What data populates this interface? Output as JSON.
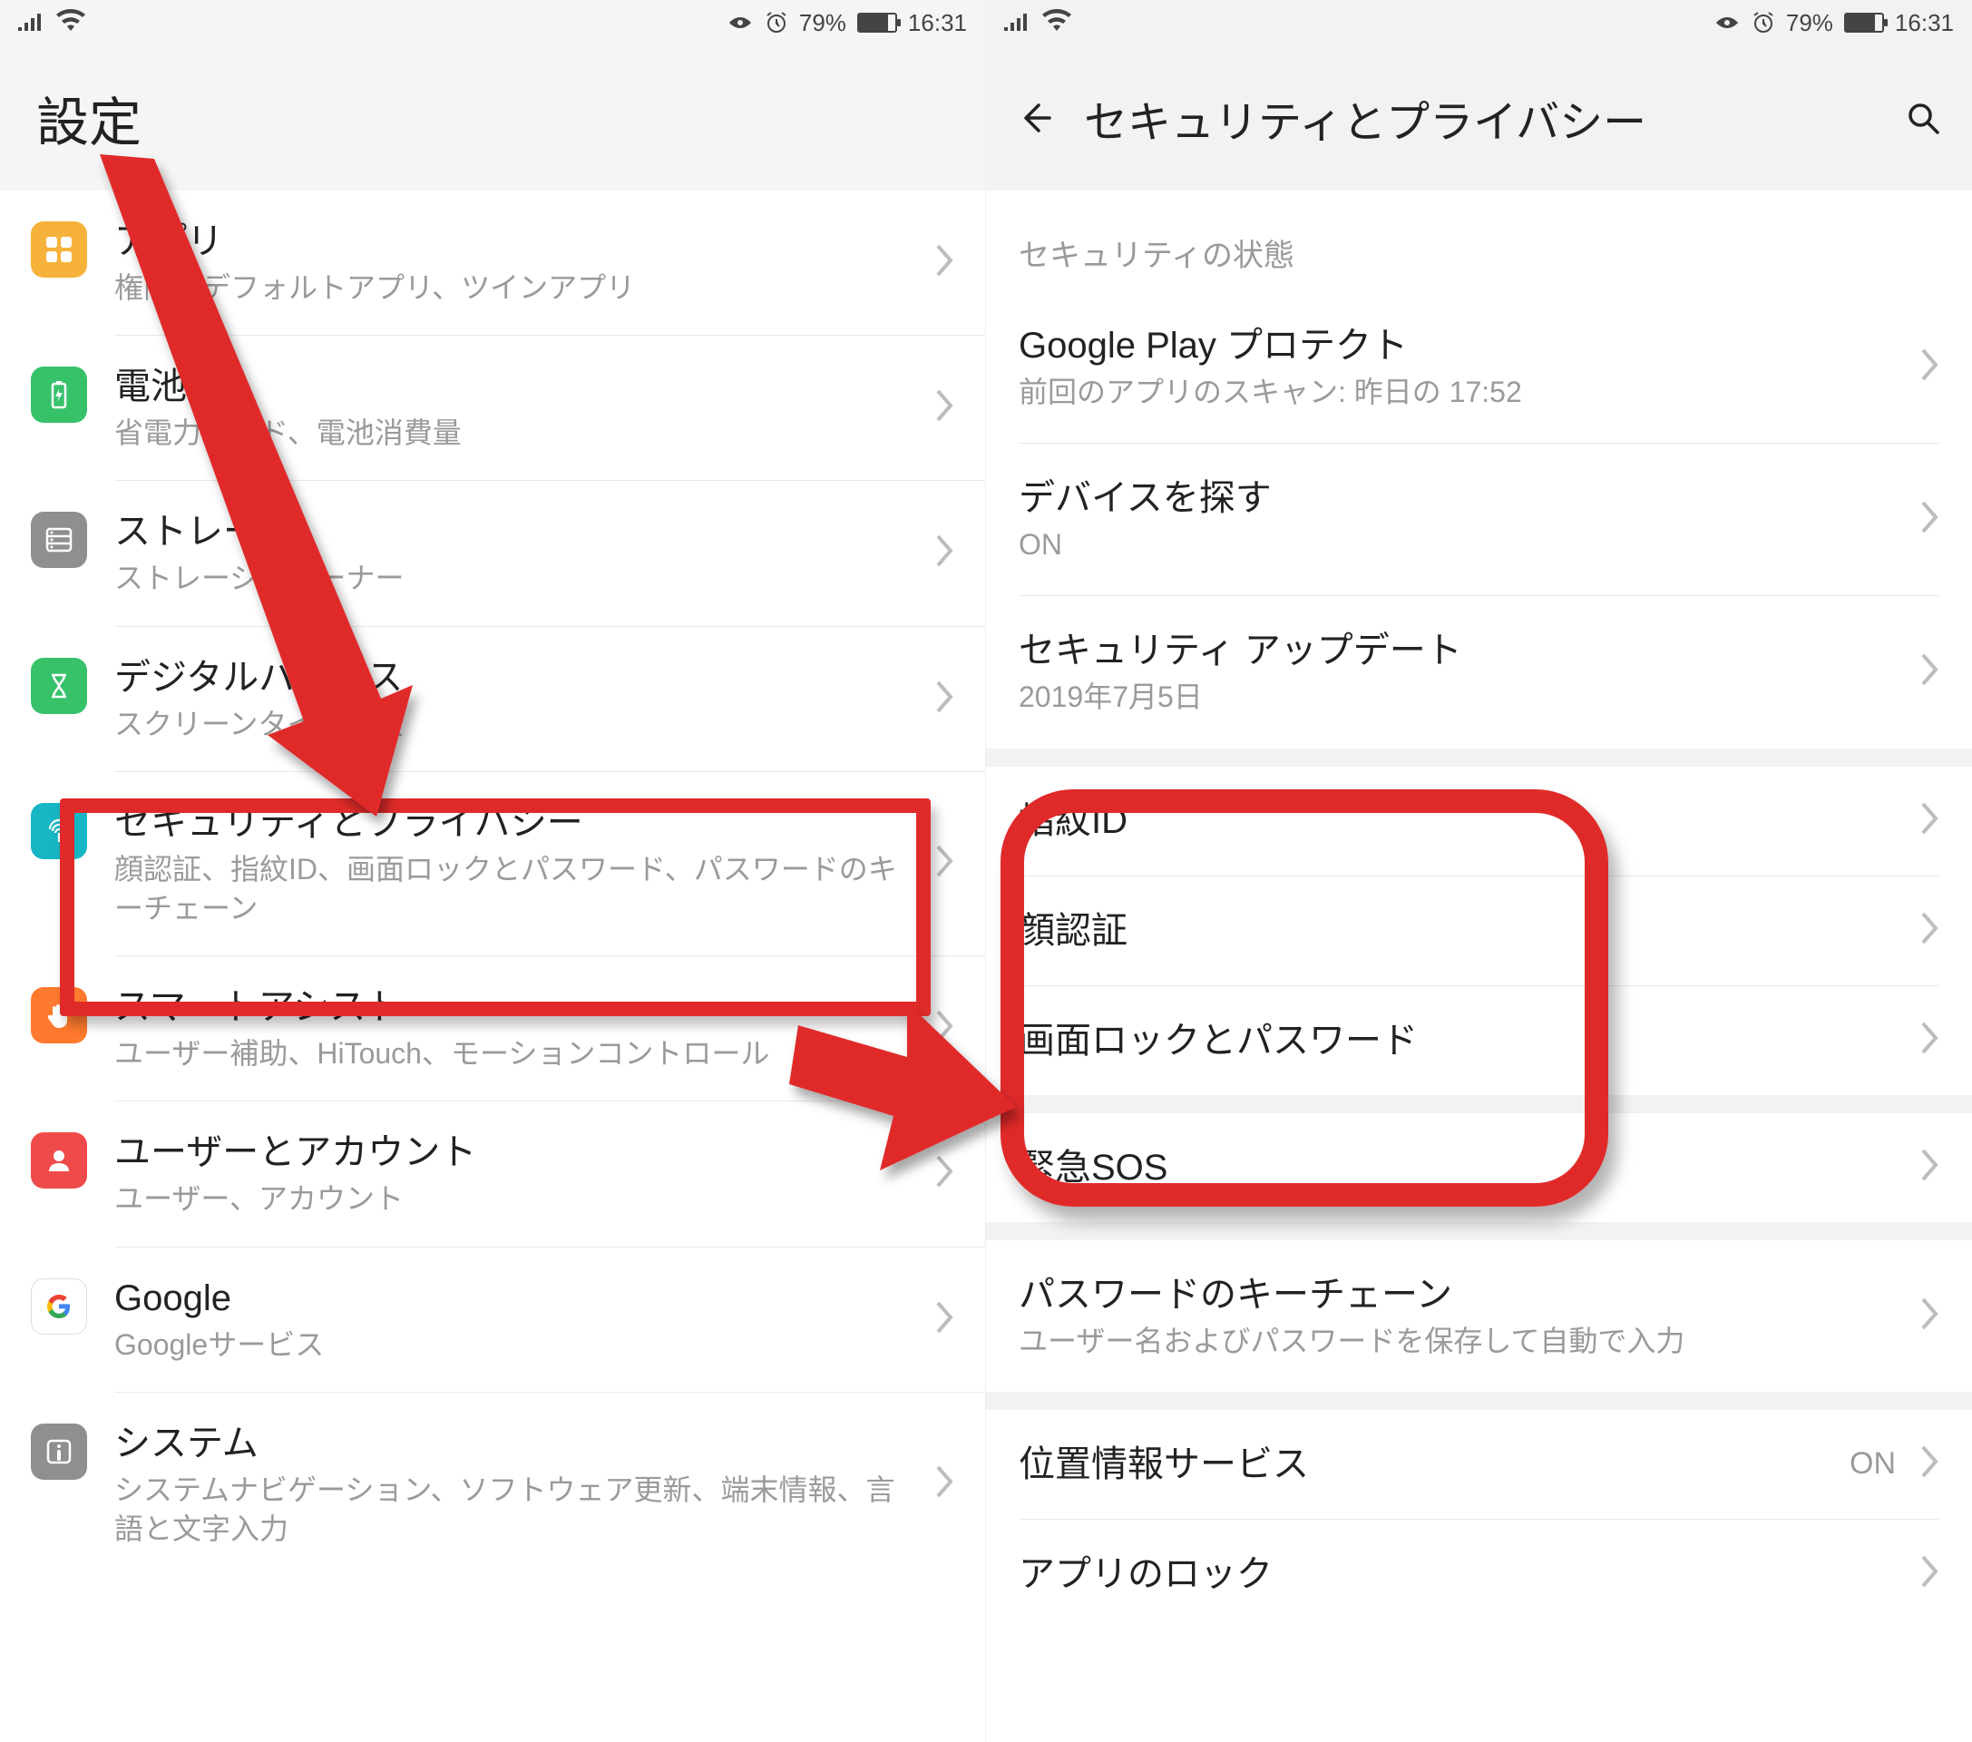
{
  "status": {
    "battery_pct": "79%",
    "time": "16:31"
  },
  "left": {
    "title": "設定",
    "items": [
      {
        "icon": "apps",
        "title": "アプリ",
        "sub": "権限、デフォルトアプリ、ツインアプリ"
      },
      {
        "icon": "battery",
        "title": "電池",
        "sub": "省電力モード、電池消費量"
      },
      {
        "icon": "storage",
        "title": "ストレージ",
        "sub": "ストレージクリーナー"
      },
      {
        "icon": "balance",
        "title": "デジタルバランス",
        "sub": "スクリーンタイム管理"
      },
      {
        "icon": "security",
        "title": "セキュリティとプライバシー",
        "sub": "顔認証、指紋ID、画面ロックとパスワード、パスワードのキーチェーン"
      },
      {
        "icon": "assist",
        "title": "スマートアシスト",
        "sub": "ユーザー補助、HiTouch、モーションコントロール"
      },
      {
        "icon": "user",
        "title": "ユーザーとアカウント",
        "sub": "ユーザー、アカウント"
      },
      {
        "icon": "google",
        "title": "Google",
        "sub": "Googleサービス"
      },
      {
        "icon": "system",
        "title": "システム",
        "sub": "システムナビゲーション、ソフトウェア更新、端末情報、言語と文字入力"
      }
    ]
  },
  "right": {
    "title": "セキュリティとプライバシー",
    "section_label": "セキュリティの状態",
    "items_top": [
      {
        "title": "Google Play プロテクト",
        "sub": "前回のアプリのスキャン: 昨日の 17:52"
      },
      {
        "title": "デバイスを探す",
        "sub": "ON"
      },
      {
        "title": "セキュリティ アップデート",
        "sub": "2019年7月5日"
      }
    ],
    "items_auth": [
      {
        "title": "指紋ID"
      },
      {
        "title": "顔認証"
      },
      {
        "title": "画面ロックとパスワード"
      }
    ],
    "items_mid": [
      {
        "title": "緊急SOS"
      }
    ],
    "items_kc": [
      {
        "title": "パスワードのキーチェーン",
        "sub": "ユーザー名およびパスワードを保存して自動で入力"
      }
    ],
    "items_bottom": [
      {
        "title": "位置情報サービス",
        "value": "ON"
      },
      {
        "title": "アプリのロック"
      }
    ]
  },
  "annotations": {
    "left_box": {
      "desc": "red rectangle around セキュリティとプライバシー"
    },
    "right_box": {
      "desc": "red rounded rectangle around 指紋ID / 顔認証 / 画面ロックとパスワード"
    },
    "arrows": {
      "desc": "two red arrows: from 設定 header to セキュリティとプライバシー, and from that row to right auth group"
    }
  }
}
